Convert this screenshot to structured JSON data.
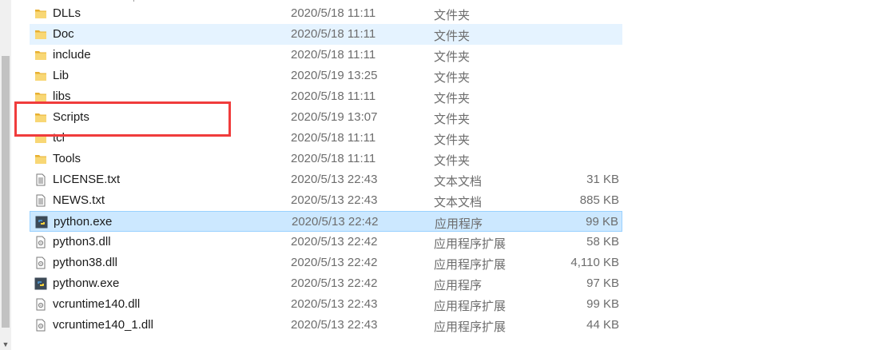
{
  "files": [
    {
      "name": "DLLs",
      "date": "2020/5/18 11:11",
      "type": "文件夹",
      "size": "",
      "icon": "folder-icon"
    },
    {
      "name": "Doc",
      "date": "2020/5/18 11:11",
      "type": "文件夹",
      "size": "",
      "icon": "folder-icon"
    },
    {
      "name": "include",
      "date": "2020/5/18 11:11",
      "type": "文件夹",
      "size": "",
      "icon": "folder-icon"
    },
    {
      "name": "Lib",
      "date": "2020/5/19 13:25",
      "type": "文件夹",
      "size": "",
      "icon": "folder-icon"
    },
    {
      "name": "libs",
      "date": "2020/5/18 11:11",
      "type": "文件夹",
      "size": "",
      "icon": "folder-icon"
    },
    {
      "name": "Scripts",
      "date": "2020/5/19 13:07",
      "type": "文件夹",
      "size": "",
      "icon": "folder-icon"
    },
    {
      "name": "tcl",
      "date": "2020/5/18 11:11",
      "type": "文件夹",
      "size": "",
      "icon": "folder-icon"
    },
    {
      "name": "Tools",
      "date": "2020/5/18 11:11",
      "type": "文件夹",
      "size": "",
      "icon": "folder-icon"
    },
    {
      "name": "LICENSE.txt",
      "date": "2020/5/13 22:43",
      "type": "文本文档",
      "size": "31 KB",
      "icon": "text-file-icon"
    },
    {
      "name": "NEWS.txt",
      "date": "2020/5/13 22:43",
      "type": "文本文档",
      "size": "885 KB",
      "icon": "text-file-icon"
    },
    {
      "name": "python.exe",
      "date": "2020/5/13 22:42",
      "type": "应用程序",
      "size": "99 KB",
      "icon": "python-exe-icon"
    },
    {
      "name": "python3.dll",
      "date": "2020/5/13 22:42",
      "type": "应用程序扩展",
      "size": "58 KB",
      "icon": "dll-file-icon"
    },
    {
      "name": "python38.dll",
      "date": "2020/5/13 22:42",
      "type": "应用程序扩展",
      "size": "4,110 KB",
      "icon": "dll-file-icon"
    },
    {
      "name": "pythonw.exe",
      "date": "2020/5/13 22:42",
      "type": "应用程序",
      "size": "97 KB",
      "icon": "python-exe-icon"
    },
    {
      "name": "vcruntime140.dll",
      "date": "2020/5/13 22:43",
      "type": "应用程序扩展",
      "size": "99 KB",
      "icon": "dll-file-icon"
    },
    {
      "name": "vcruntime140_1.dll",
      "date": "2020/5/13 22:43",
      "type": "应用程序扩展",
      "size": "44 KB",
      "icon": "dll-file-icon"
    }
  ],
  "state": {
    "hovered_row": "Doc",
    "selected_row": "python.exe",
    "annotated_row": "Scripts"
  },
  "colors": {
    "annotation": "#f03c3c",
    "selection": "#cce8ff",
    "hover": "#e5f3ff",
    "folder": "#f5c242"
  }
}
